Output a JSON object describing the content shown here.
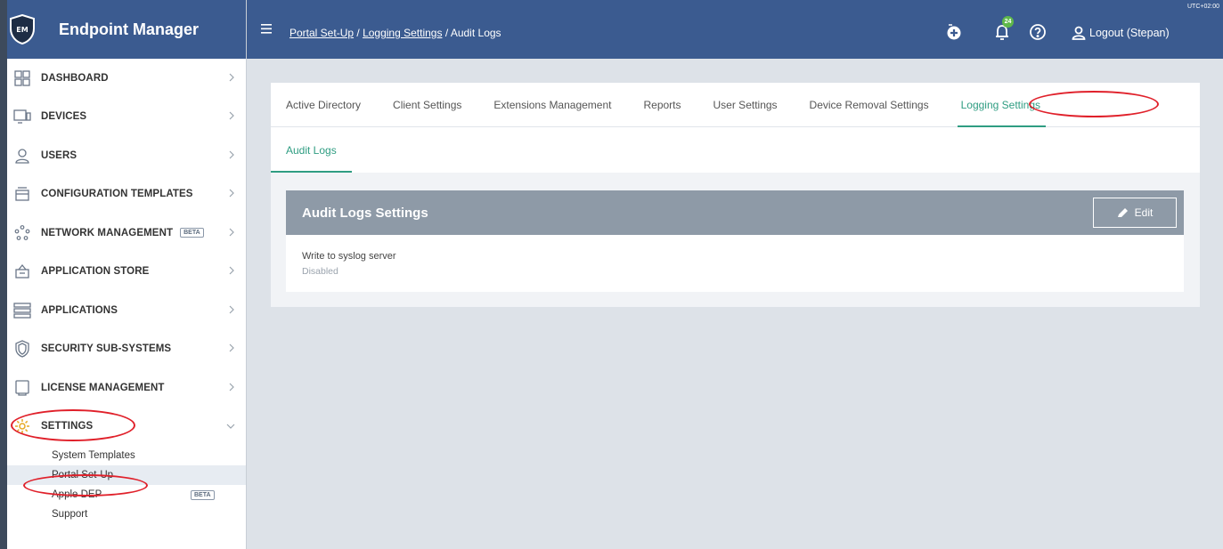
{
  "app": {
    "title": "Endpoint Manager",
    "logo_text": "EM"
  },
  "sidebar": {
    "items": [
      {
        "label": "DASHBOARD",
        "icon": "grid-icon"
      },
      {
        "label": "DEVICES",
        "icon": "monitor-icon"
      },
      {
        "label": "USERS",
        "icon": "user-icon"
      },
      {
        "label": "CONFIGURATION TEMPLATES",
        "icon": "template-icon"
      },
      {
        "label": "NETWORK MANAGEMENT",
        "icon": "network-icon",
        "badge": "BETA"
      },
      {
        "label": "APPLICATION STORE",
        "icon": "basket-icon"
      },
      {
        "label": "APPLICATIONS",
        "icon": "server-icon"
      },
      {
        "label": "SECURITY SUB-SYSTEMS",
        "icon": "shield-icon"
      },
      {
        "label": "LICENSE MANAGEMENT",
        "icon": "license-icon"
      },
      {
        "label": "SETTINGS",
        "icon": "gear-icon"
      }
    ],
    "sub_items": [
      {
        "label": "System Templates"
      },
      {
        "label": "Portal Set-Up",
        "active": true
      },
      {
        "label": "Apple DEP",
        "badge": "BETA"
      },
      {
        "label": "Support"
      }
    ]
  },
  "topbar": {
    "breadcrumb": {
      "link1": "Portal Set-Up",
      "sep": "/",
      "link2": "Logging Settings",
      "current": "Audit Logs"
    },
    "notification_count": "24",
    "logout_label": "Logout (Stepan)",
    "timezone": "UTC+02:00"
  },
  "tabs": [
    {
      "label": "Active Directory"
    },
    {
      "label": "Client Settings"
    },
    {
      "label": "Extensions Management"
    },
    {
      "label": "Reports"
    },
    {
      "label": "User Settings"
    },
    {
      "label": "Device Removal Settings"
    },
    {
      "label": "Logging Settings",
      "active": true
    }
  ],
  "subtab": {
    "label": "Audit Logs"
  },
  "panel": {
    "title": "Audit Logs Settings",
    "edit_label": "Edit",
    "field_label": "Write to syslog server",
    "field_value": "Disabled"
  },
  "colors": {
    "header": "#3b5b90",
    "accent": "#2f9d82",
    "panel_head": "#8e9aa7",
    "highlight_ring": "#e0202a",
    "badge_green": "#5fb84a"
  }
}
